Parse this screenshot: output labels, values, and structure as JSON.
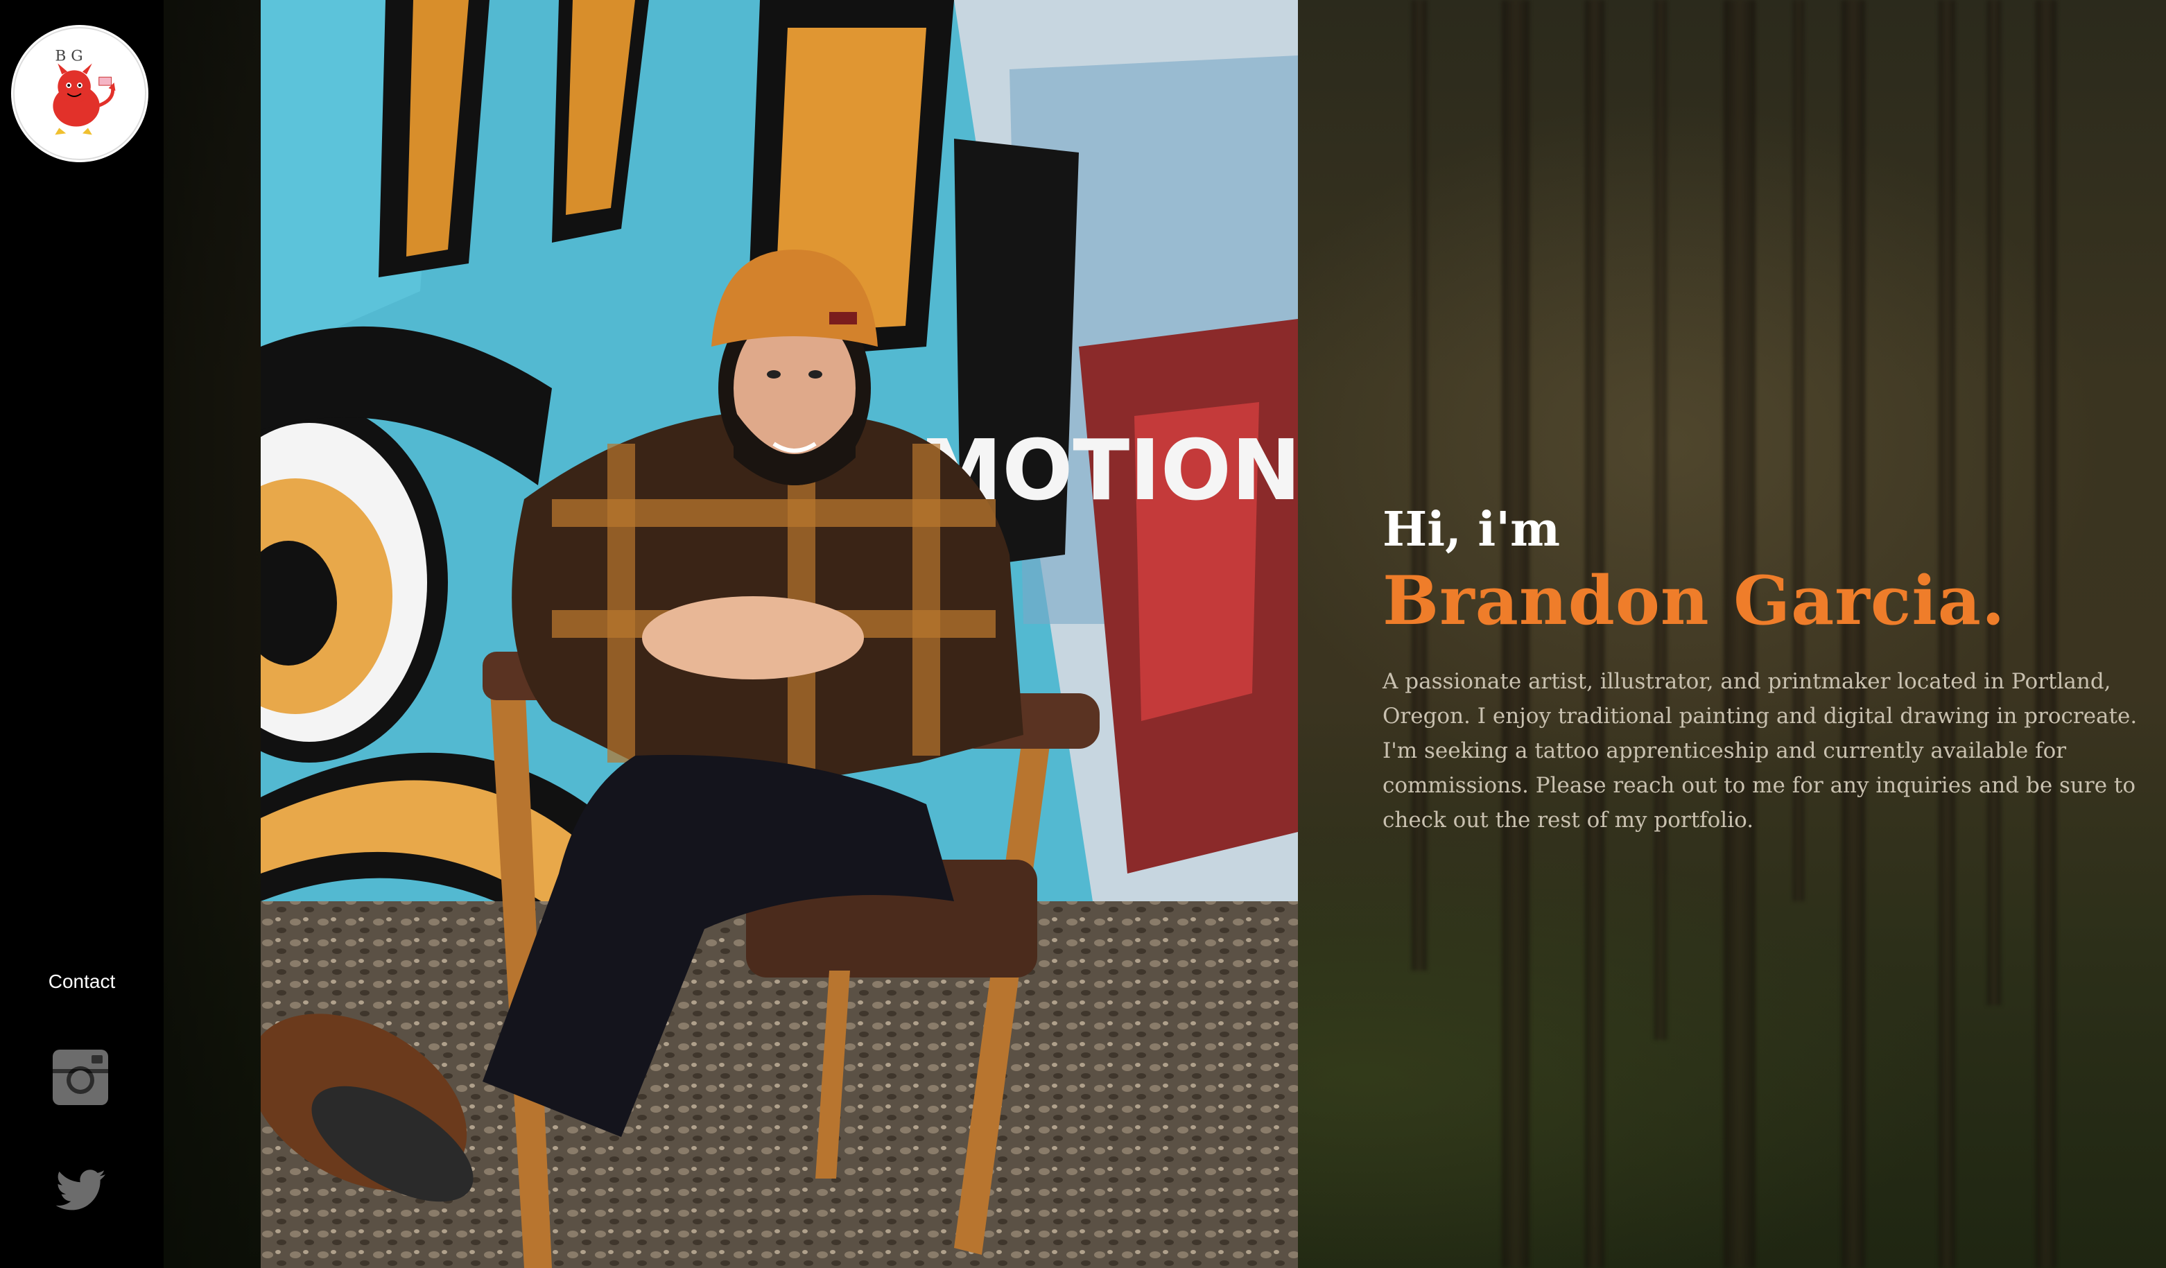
{
  "sidebar": {
    "logo_text": "B G",
    "contact_label": "Contact",
    "socials": [
      "instagram-icon",
      "twitter-icon"
    ]
  },
  "hero": {
    "greeting": "Hi, i'm",
    "name": "Brandon Garcia",
    "name_suffix": ".",
    "bio": "A passionate artist, illustrator, and printmaker located in Portland, Oregon. I  enjoy traditional painting and digital drawing in procreate. I'm  seeking a tattoo apprenticeship and currently available for commissions. Please reach out to me for any inquiries and be sure to check out the rest of my portfolio."
  },
  "photo": {
    "graffiti_text": "MOTION"
  },
  "colors": {
    "accent": "#ef7d2a",
    "sidebar_bg": "#000000",
    "text_light": "#ffffff",
    "text_muted": "#c9c1b0"
  }
}
